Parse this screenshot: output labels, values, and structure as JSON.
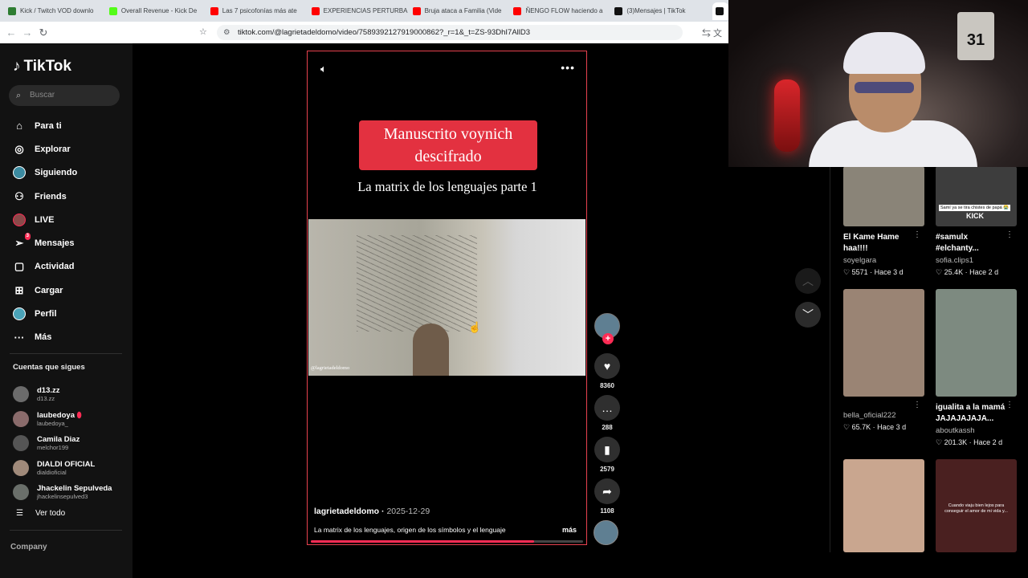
{
  "browser": {
    "tabs": [
      {
        "label": "Kick / Twitch VOD downlo",
        "color": "#2e7d32"
      },
      {
        "label": "Overall Revenue - Kick De",
        "color": "#53fc18"
      },
      {
        "label": "Las 7 psicofonías más ate",
        "color": "#ff0000"
      },
      {
        "label": "EXPERIENCIAS PERTURBA",
        "color": "#ff0000"
      },
      {
        "label": "Bruja ataca a Familia (Vide",
        "color": "#ff0000"
      },
      {
        "label": "ÑENGO FLOW haciendo a",
        "color": "#ff0000"
      },
      {
        "label": "(3)Mensajes | TikTok",
        "color": "#111111"
      }
    ],
    "url": "tiktok.com/@lagrietadeldomo/video/7589392127919000862?_r=1&_t=ZS-93DhI7AllD3"
  },
  "sidebar": {
    "logo": "TikTok",
    "search_placeholder": "Buscar",
    "nav": [
      {
        "label": "Para ti",
        "icon": "home-icon",
        "glyph": "⌂"
      },
      {
        "label": "Explorar",
        "icon": "compass-icon",
        "glyph": "◎"
      },
      {
        "label": "Siguiendo",
        "icon": "following-avatar-icon",
        "glyph": ""
      },
      {
        "label": "Friends",
        "icon": "friends-icon",
        "glyph": "👥"
      },
      {
        "label": "LIVE",
        "icon": "live-avatar-icon",
        "glyph": ""
      },
      {
        "label": "Mensajes",
        "icon": "messages-icon",
        "glyph": "➢",
        "badge": "3"
      },
      {
        "label": "Actividad",
        "icon": "activity-icon",
        "glyph": "▢"
      },
      {
        "label": "Cargar",
        "icon": "upload-icon",
        "glyph": "⊞"
      },
      {
        "label": "Perfil",
        "icon": "profile-avatar-icon",
        "glyph": ""
      },
      {
        "label": "Más",
        "icon": "more-icon",
        "glyph": "···"
      }
    ],
    "following_title": "Cuentas que sigues",
    "following": [
      {
        "name": "d13.zz",
        "handle": "d13.zz"
      },
      {
        "name": "laubedoya",
        "handle": "laubedoya_"
      },
      {
        "name": "Camila Diaz",
        "handle": "melchor199"
      },
      {
        "name": "DIALDI OFICIAL",
        "handle": "dialdioficial"
      },
      {
        "name": "Jhackelin Sepulveda",
        "handle": "jhackelinsepulved3"
      }
    ],
    "see_all": "Ver todo",
    "company": "Company"
  },
  "video": {
    "title": "Manuscrito voynich descifrado",
    "subtitle": "La matrix de los lenguajes parte 1",
    "watermark": "@lagrietadeldomo",
    "author": "lagrietadeldomo",
    "date": "2025-12-29",
    "description": "La matrix de los lenguajes, origen de los símbolos y el lenguaje",
    "more": "más",
    "progress": 0.82
  },
  "actions": {
    "likes": "8360",
    "comments": "288",
    "saves": "2579",
    "shares": "1108"
  },
  "recommendations": [
    {
      "title": "El Kame Hame haa!!!!",
      "user": "soyelgara",
      "likes": "5571",
      "age": "Hace 3 d",
      "color": "#8a8478"
    },
    {
      "title": "#samulx #elchanty...",
      "user": "sofia.clips1",
      "likes": "25.4K",
      "age": "Hace 2 d",
      "color": "#3d3d3d",
      "overlay": "Samí ya se tira chistes de papá 😭",
      "brand": "KICK"
    },
    {
      "title": "",
      "user": "bella_oficial222",
      "likes": "65.7K",
      "age": "Hace 3 d",
      "color": "#9a8474"
    },
    {
      "title": "igualita a la mamá JAJAJAJAJA...",
      "user": "aboutkassh",
      "likes": "201.3K",
      "age": "Hace 2 d",
      "color": "#7d8a80"
    },
    {
      "title": "",
      "user": "",
      "likes": "",
      "age": "",
      "color": "#c9a68f"
    },
    {
      "title": "",
      "user": "",
      "likes": "",
      "age": "",
      "color": "#4a2020",
      "overlay": "Cuando viaju bien lejos para conseguir el amor de mi vida y..."
    }
  ]
}
